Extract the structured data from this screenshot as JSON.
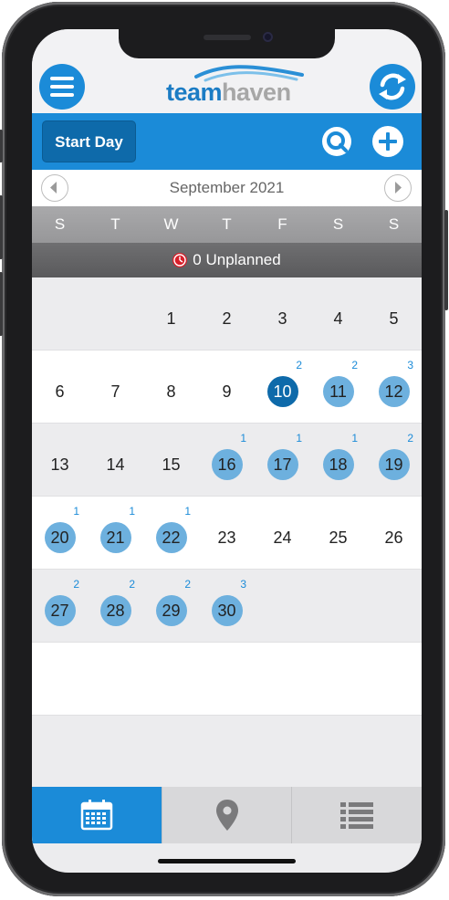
{
  "app": {
    "logo_part1": "team",
    "logo_part2": "haven"
  },
  "toolbar": {
    "start_day_label": "Start Day"
  },
  "calendar": {
    "month_label": "September 2021",
    "weekdays": [
      "S",
      "T",
      "W",
      "T",
      "F",
      "S",
      "S"
    ],
    "unplanned_label": "0 Unplanned",
    "weeks": [
      [
        {
          "day": "",
          "count": ""
        },
        {
          "day": "",
          "count": ""
        },
        {
          "day": "1",
          "count": ""
        },
        {
          "day": "2",
          "count": ""
        },
        {
          "day": "3",
          "count": ""
        },
        {
          "day": "4",
          "count": ""
        },
        {
          "day": "5",
          "count": ""
        }
      ],
      [
        {
          "day": "6",
          "count": ""
        },
        {
          "day": "7",
          "count": ""
        },
        {
          "day": "8",
          "count": ""
        },
        {
          "day": "9",
          "count": ""
        },
        {
          "day": "10",
          "count": "2",
          "today": true
        },
        {
          "day": "11",
          "count": "2"
        },
        {
          "day": "12",
          "count": "3"
        }
      ],
      [
        {
          "day": "13",
          "count": ""
        },
        {
          "day": "14",
          "count": ""
        },
        {
          "day": "15",
          "count": ""
        },
        {
          "day": "16",
          "count": "1"
        },
        {
          "day": "17",
          "count": "1"
        },
        {
          "day": "18",
          "count": "1"
        },
        {
          "day": "19",
          "count": "2"
        }
      ],
      [
        {
          "day": "20",
          "count": "1"
        },
        {
          "day": "21",
          "count": "1"
        },
        {
          "day": "22",
          "count": "1"
        },
        {
          "day": "23",
          "count": ""
        },
        {
          "day": "24",
          "count": ""
        },
        {
          "day": "25",
          "count": ""
        },
        {
          "day": "26",
          "count": ""
        }
      ],
      [
        {
          "day": "27",
          "count": "2"
        },
        {
          "day": "28",
          "count": "2"
        },
        {
          "day": "29",
          "count": "2"
        },
        {
          "day": "30",
          "count": "3"
        },
        {
          "day": "",
          "count": ""
        },
        {
          "day": "",
          "count": ""
        },
        {
          "day": "",
          "count": ""
        }
      ],
      [
        {
          "day": "",
          "count": ""
        },
        {
          "day": "",
          "count": ""
        },
        {
          "day": "",
          "count": ""
        },
        {
          "day": "",
          "count": ""
        },
        {
          "day": "",
          "count": ""
        },
        {
          "day": "",
          "count": ""
        },
        {
          "day": "",
          "count": ""
        }
      ]
    ]
  },
  "tabs": [
    {
      "icon": "calendar-icon",
      "active": true
    },
    {
      "icon": "map-pin-icon",
      "active": false
    },
    {
      "icon": "list-icon",
      "active": false
    }
  ],
  "colors": {
    "accent": "#1b8bd8",
    "accent_dark": "#0e6aaa",
    "day_marker": "#6db0de",
    "alert": "#d81f2a"
  }
}
